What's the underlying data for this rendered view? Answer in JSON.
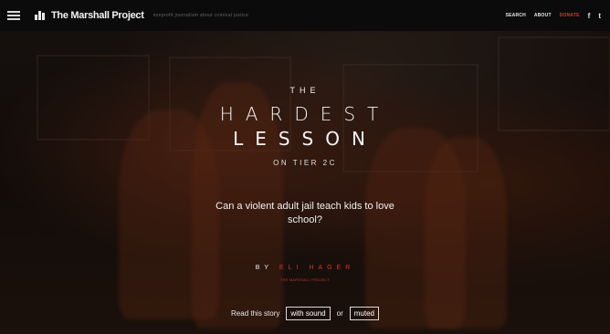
{
  "header": {
    "brand": "The Marshall Project",
    "tagline": "nonprofit journalism about criminal justice",
    "nav": {
      "search": "SEARCH",
      "about": "ABOUT",
      "donate": "DONATE",
      "facebook": "f",
      "twitter": "t"
    }
  },
  "hero": {
    "kicker": "THE",
    "title_line1": "HARDEST",
    "title_line2": "LESSON",
    "subtitle": "ON TIER 2C",
    "dek": "Can a violent adult jail teach kids to love school?",
    "byline_prefix": "BY",
    "byline_name": "ELI HAGER",
    "byline_sub": "THE MARSHALL PROJECT"
  },
  "cta": {
    "lead": "Read this story",
    "with_sound": "with sound",
    "or": "or",
    "muted": "muted"
  },
  "colors": {
    "accent": "#d8352c",
    "topbar": "#0b0b0b"
  }
}
